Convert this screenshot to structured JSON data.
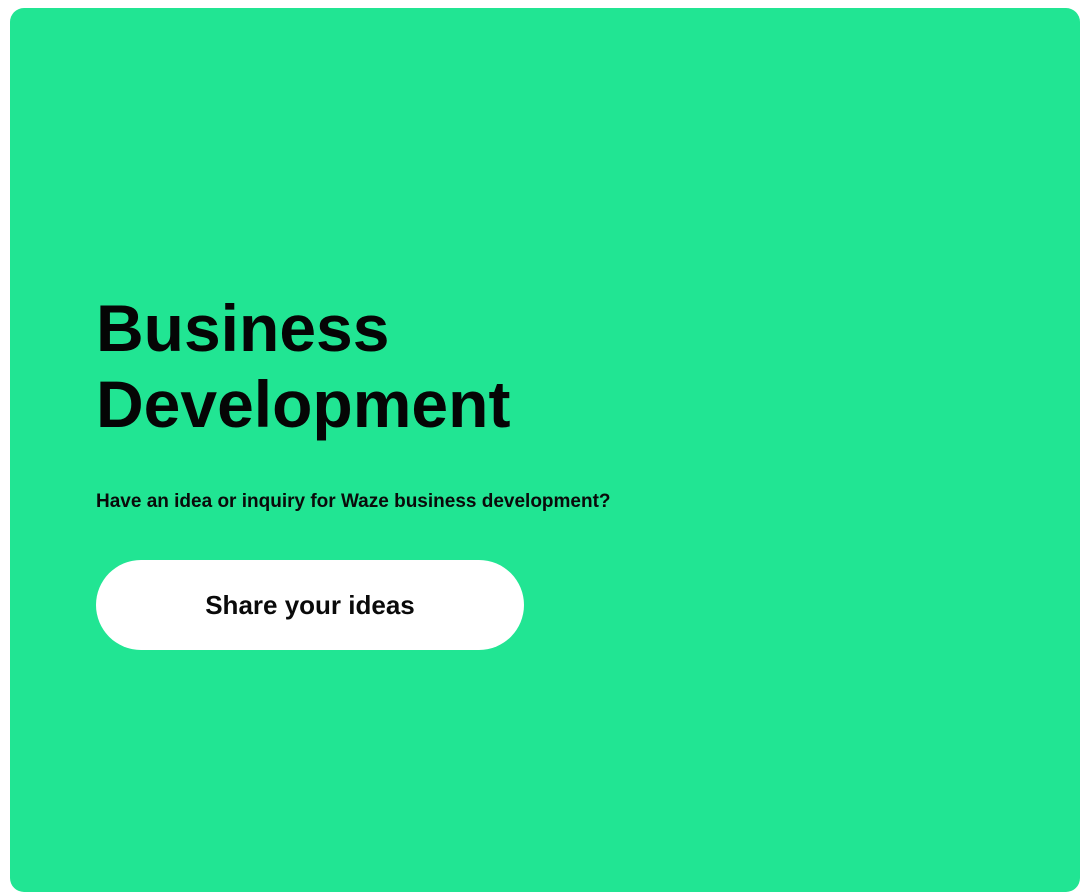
{
  "card": {
    "background_color": "#21e593",
    "title_line1": "Business",
    "title_line2": "Development",
    "description": "Have an idea or inquiry for Waze business development?",
    "cta_label": "Share your ideas",
    "cta_background": "#ffffff"
  }
}
